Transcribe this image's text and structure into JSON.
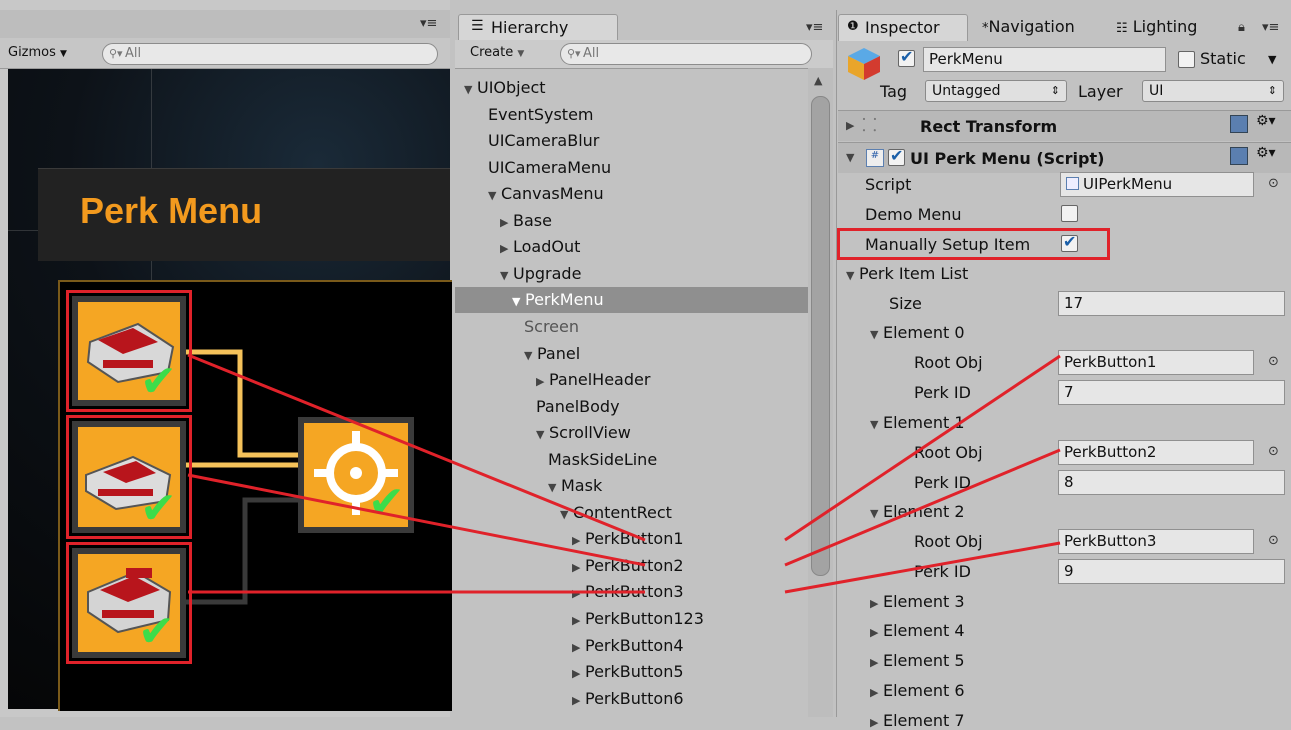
{
  "scene": {
    "gizmos_label": "Gizmos",
    "search_placeholder": "All",
    "perk_menu_title": "Perk Menu"
  },
  "hierarchy": {
    "tab_label": "Hierarchy",
    "create_label": "Create",
    "search_placeholder": "All",
    "items": [
      {
        "label": "UIObject",
        "indent": 0,
        "arrow": "down"
      },
      {
        "label": "EventSystem",
        "indent": 2,
        "arrow": "none"
      },
      {
        "label": "UICameraBlur",
        "indent": 2,
        "arrow": "none"
      },
      {
        "label": "UICameraMenu",
        "indent": 2,
        "arrow": "none"
      },
      {
        "label": "CanvasMenu",
        "indent": 2,
        "arrow": "down"
      },
      {
        "label": "Base",
        "indent": 3,
        "arrow": "right"
      },
      {
        "label": "LoadOut",
        "indent": 3,
        "arrow": "right"
      },
      {
        "label": "Upgrade",
        "indent": 3,
        "arrow": "down"
      },
      {
        "label": "PerkMenu",
        "indent": 4,
        "arrow": "down",
        "selected": true
      },
      {
        "label": "Screen",
        "indent": 5,
        "arrow": "none",
        "dim": true
      },
      {
        "label": "Panel",
        "indent": 5,
        "arrow": "down"
      },
      {
        "label": "PanelHeader",
        "indent": 6,
        "arrow": "right"
      },
      {
        "label": "PanelBody",
        "indent": 6,
        "arrow": "none"
      },
      {
        "label": "ScrollView",
        "indent": 6,
        "arrow": "down"
      },
      {
        "label": "MaskSideLine",
        "indent": 7,
        "arrow": "none"
      },
      {
        "label": "Mask",
        "indent": 7,
        "arrow": "down"
      },
      {
        "label": "ContentRect",
        "indent": 8,
        "arrow": "down"
      },
      {
        "label": "PerkButton1",
        "indent": 9,
        "arrow": "right"
      },
      {
        "label": "PerkButton2",
        "indent": 9,
        "arrow": "right"
      },
      {
        "label": "PerkButton3",
        "indent": 9,
        "arrow": "right"
      },
      {
        "label": "PerkButton123",
        "indent": 9,
        "arrow": "right"
      },
      {
        "label": "PerkButton4",
        "indent": 9,
        "arrow": "right"
      },
      {
        "label": "PerkButton5",
        "indent": 9,
        "arrow": "right"
      },
      {
        "label": "PerkButton6",
        "indent": 9,
        "arrow": "right"
      }
    ]
  },
  "inspector": {
    "tabs": {
      "inspector": "Inspector",
      "navigation": "Navigation",
      "lighting": "Lighting"
    },
    "object_name": "PerkMenu",
    "static_label": "Static",
    "tag_label": "Tag",
    "tag_value": "Untagged",
    "layer_label": "Layer",
    "layer_value": "UI",
    "rect_transform_label": "Rect Transform",
    "script_component_label": "UI Perk Menu (Script)",
    "script_label": "Script",
    "script_value": "UIPerkMenu",
    "demo_menu_label": "Demo Menu",
    "manual_setup_label": "Manually Setup Item",
    "perk_item_list_label": "Perk Item List",
    "size_label": "Size",
    "size_value": "17",
    "root_obj_label": "Root Obj",
    "perk_id_label": "Perk ID",
    "elements_expanded": [
      {
        "label": "Element 0",
        "root_obj": "PerkButton1",
        "perk_id": "7"
      },
      {
        "label": "Element 1",
        "root_obj": "PerkButton2",
        "perk_id": "8"
      },
      {
        "label": "Element 2",
        "root_obj": "PerkButton3",
        "perk_id": "9"
      }
    ],
    "elements_collapsed": [
      "Element 3",
      "Element 4",
      "Element 5",
      "Element 6",
      "Element 7"
    ]
  },
  "colors": {
    "highlight_red": "#e0222a",
    "perk_orange": "#f5a623",
    "title_orange": "#f39a1e",
    "check_green": "#3ddc4a"
  }
}
